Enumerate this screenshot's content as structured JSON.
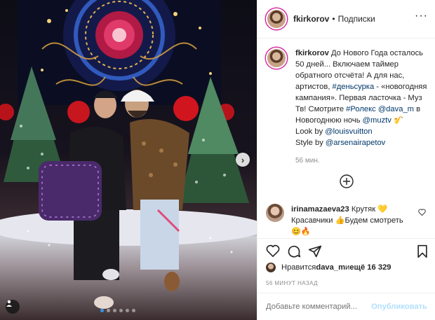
{
  "post": {
    "username": "fkirkorov",
    "separator": "•",
    "follow_label": "Подписки",
    "more_label": "···"
  },
  "caption": {
    "username": "fkirkorov",
    "part1": " До Нового Года осталось 50 дней... Включаем таймер обратного отсчёта! А для нас, артистов, ",
    "tag1": "#деньсурка",
    "part2": " - «новогодняя кампания». Первая ласточка - Муз Тв! Смотрите ",
    "tag2": "#Ролекс",
    "space1": " ",
    "mention1": "@dava_m",
    "part3": " в Новогоднюю ночь ",
    "mention2": "@muztv",
    "part4": " 🎷",
    "look_prefix": "Look by ",
    "mention3": "@louisvuitton",
    "style_prefix": "Style by ",
    "mention4": "@arsenairapetov",
    "time": "56 мин."
  },
  "comment": {
    "username": "irinamazaeva23",
    "text": " Крутяк 💛 Красавчики 👍Будем смотреть 😊🔥"
  },
  "likes": {
    "prefix": "Нравится ",
    "user": "dava_m",
    "middle": " и ",
    "count": "ещё 16 329"
  },
  "posted_ago": "56 МИНУТ НАЗАД",
  "add_comment": {
    "placeholder": "Добавьте комментарий...",
    "post_label": "Опубликовать"
  },
  "carousel": {
    "next_label": "›",
    "slide_count": 6,
    "active_index": 0
  },
  "colors": {
    "link": "#00376b",
    "carousel_active": "#3897f0",
    "post_button": "#b2dffc",
    "meta": "#8e8e8e"
  }
}
